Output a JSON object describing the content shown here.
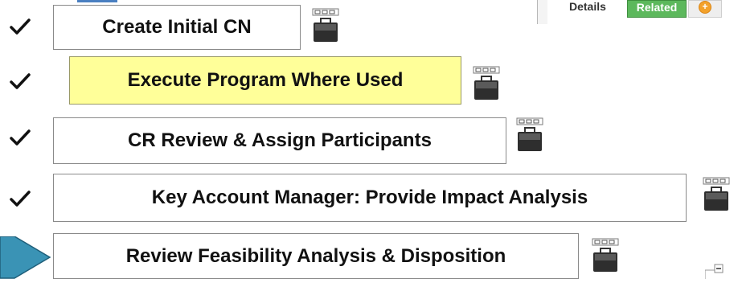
{
  "tabs": {
    "details": "Details",
    "related": "Related",
    "add_icon": "plus-circle-icon"
  },
  "steps": [
    {
      "label": "Create Initial CN",
      "status": "complete",
      "highlight": false
    },
    {
      "label": "Execute Program Where Used",
      "status": "complete",
      "highlight": true
    },
    {
      "label": "CR Review & Assign Participants",
      "status": "complete",
      "highlight": false
    },
    {
      "label": "Key Account Manager: Provide Impact Analysis",
      "status": "complete",
      "highlight": false
    },
    {
      "label": "Review Feasibility Analysis & Disposition",
      "status": "current",
      "highlight": false
    }
  ],
  "colors": {
    "highlight": "#ffff99",
    "related_tab": "#5cb85c",
    "current_arrow": "#3a93b5"
  },
  "icons": {
    "complete": "checkmark-icon",
    "task_action": "briefcase-icon",
    "current": "current-step-arrow-icon",
    "expand": "collapse-toggle-icon"
  }
}
